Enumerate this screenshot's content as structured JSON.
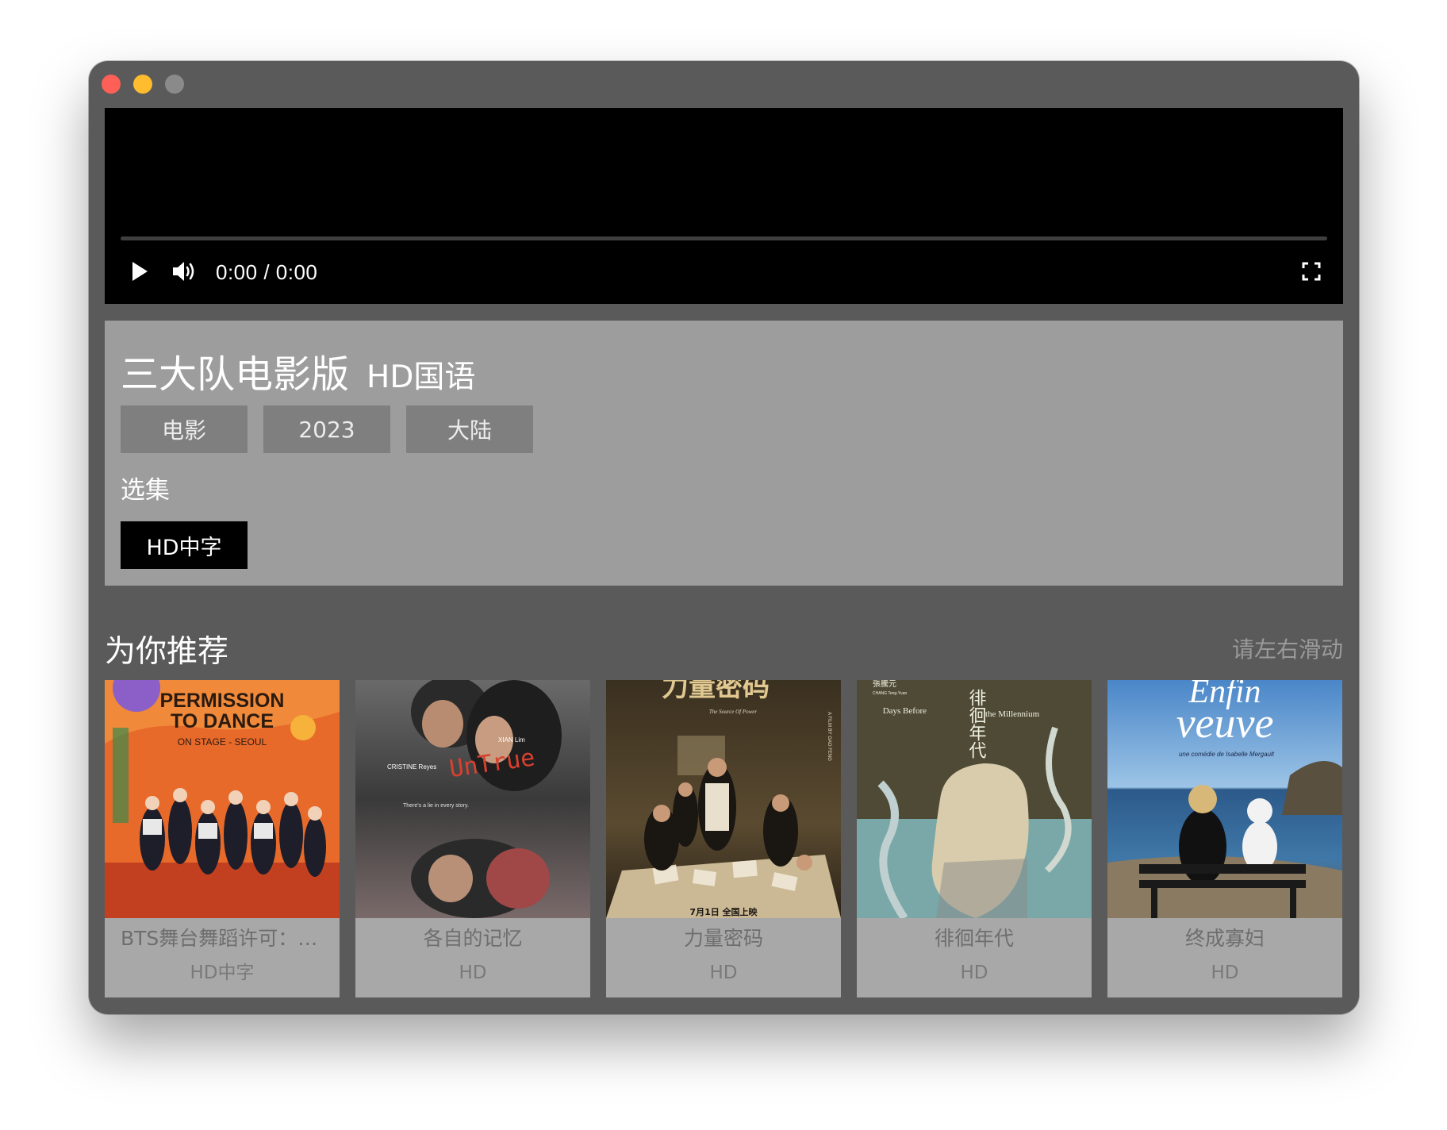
{
  "player": {
    "time": "0:00 / 0:00",
    "progress": 0
  },
  "movie": {
    "title": "三大队电影版",
    "quality": "HD国语",
    "tags": [
      "电影",
      "2023",
      "大陆"
    ],
    "episodes_label": "选集",
    "episodes": [
      "HD中字"
    ]
  },
  "recommend": {
    "title": "为你推荐",
    "hint": "请左右滑动",
    "items": [
      {
        "title": "BTS舞台舞蹈许可：首尔",
        "badge": "HD中字",
        "poster": {
          "line1": "PERMISSION",
          "line2": "TO DANCE",
          "line3": "ON STAGE - SEOUL"
        }
      },
      {
        "title": "各自的记忆",
        "badge": "HD",
        "poster": {
          "title": "UnTrue",
          "credit_left": "CRISTINE Reyes",
          "credit_right": "XIAN Lim",
          "tagline": "There's a lie in every story."
        }
      },
      {
        "title": "力量密码",
        "badge": "HD",
        "poster": {
          "title": "力量密码",
          "subtitle": "The Source Of Power",
          "side": "A FILM BY GAO FENG",
          "date": "7月1日 全国上映"
        }
      },
      {
        "title": "徘徊年代",
        "badge": "HD",
        "poster": {
          "director": "張騰元",
          "director_en": "CHANG Teng-Yuan",
          "title_cn": "徘徊年代",
          "title_en_left": "Days Before",
          "title_en_right": "the Millennium"
        }
      },
      {
        "title": "终成寡妇",
        "badge": "HD",
        "poster": {
          "title_line1": "Enfin",
          "title_line2": "veuve",
          "credit": "une comédie de Isabelle Mergault"
        }
      }
    ]
  },
  "colors": {
    "window_bg": "#5a5a5a",
    "info_panel": "#9d9d9d",
    "tag_bg": "#7f7f7f",
    "card_bg": "#a8a8a8",
    "close": "#fe5f57",
    "minimize": "#febc2e",
    "zoom_inactive": "#8a8a8a"
  }
}
